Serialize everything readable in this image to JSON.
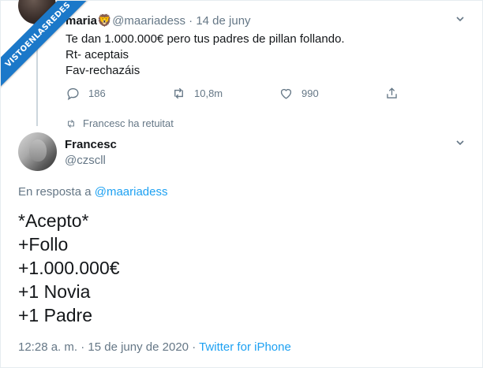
{
  "watermark": {
    "text": "VISTOENLASREDES"
  },
  "tweet1": {
    "name": "maria",
    "emoji": "🦁",
    "handle": "@maariadess",
    "separator": "·",
    "date": "14 de juny",
    "lines": [
      "Te dan 1.000.000€ pero tus padres de pillan follando.",
      "Rt- aceptais",
      "Fav-rechazáis"
    ],
    "replies": "186",
    "retweets": "10,8m",
    "likes": "990"
  },
  "retweet_context": {
    "text": "Francesc ha retuitat"
  },
  "tweet2": {
    "name": "Francesc",
    "handle": "@czscll",
    "reply_prefix": "En resposta a ",
    "reply_handle": "@maariadess",
    "lines": [
      "*Acepto*",
      "+Follo",
      "+1.000.000€",
      "+1 Novia",
      "+1 Padre"
    ],
    "time": "12:28 a. m.",
    "separator1": "·",
    "date": "15 de juny de 2020",
    "separator2": "·",
    "source": "Twitter for iPhone"
  },
  "icons": {
    "reply": "reply-icon",
    "retweet": "retweet-icon",
    "like": "heart-icon",
    "share": "share-icon",
    "more": "chevron-down-icon"
  },
  "colors": {
    "accent": "#1da1f2",
    "muted": "#657786",
    "text": "#14171a",
    "watermark": "#1b78c9"
  }
}
